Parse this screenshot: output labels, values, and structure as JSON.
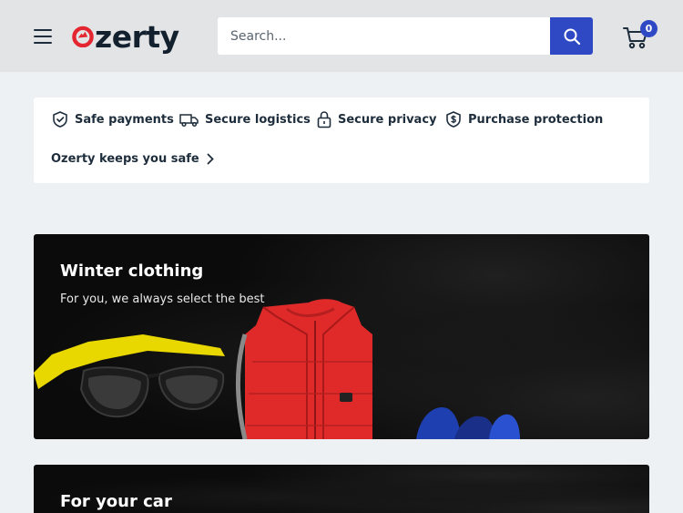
{
  "header": {
    "logo_text": "zerty",
    "search_placeholder": "Search...",
    "cart_count": "0"
  },
  "trust": {
    "items": [
      {
        "label": "Safe payments",
        "icon": "shield-check-icon"
      },
      {
        "label": "Secure logistics",
        "icon": "truck-icon"
      },
      {
        "label": "Secure privacy",
        "icon": "lock-icon"
      },
      {
        "label": "Purchase protection",
        "icon": "shield-dollar-icon"
      }
    ],
    "link_label": "Ozerty keeps you safe"
  },
  "banners": [
    {
      "title": "Winter clothing",
      "subtitle": "For you, we always select the best"
    },
    {
      "title": "For your car"
    }
  ],
  "colors": {
    "accent": "#2f49c5",
    "logo_red": "#e3262f",
    "header_bg": "#e3e4e6",
    "page_bg": "#eef1f4"
  }
}
